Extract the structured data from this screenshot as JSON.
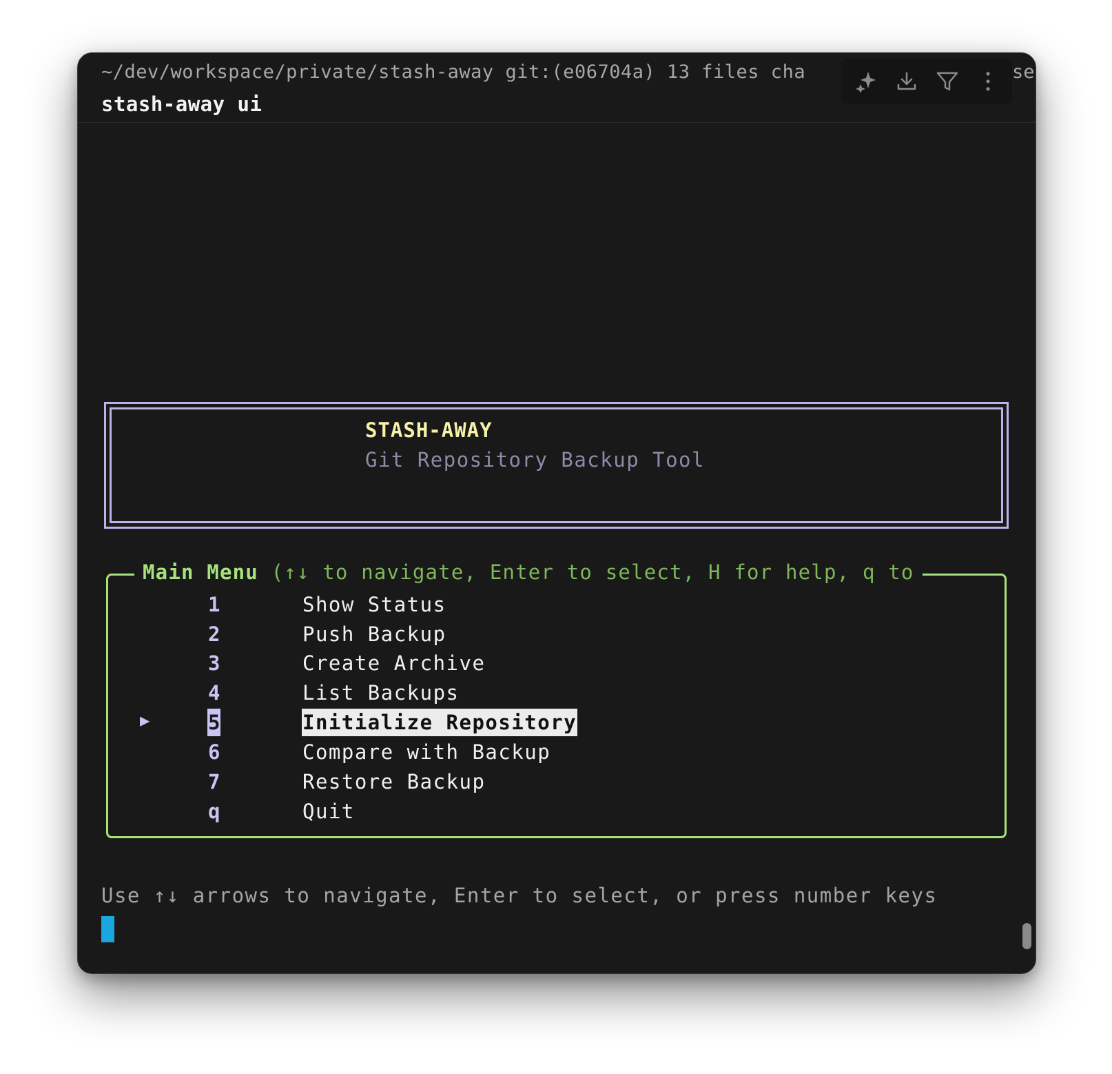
{
  "terminal": {
    "prompt_line": "~/dev/workspace/private/stash-away git:(e06704a)  13 files cha",
    "prompt_overflow": "se",
    "command": "stash-away ui",
    "toolbar": {
      "icons": [
        "sparkle-icon",
        "download-icon",
        "filter-icon",
        "more-vertical-icon"
      ]
    }
  },
  "banner": {
    "title": "STASH-AWAY",
    "subtitle": "Git Repository Backup Tool"
  },
  "menu": {
    "title": "Main Menu",
    "hint": "(↑↓ to navigate, Enter to select, H for help, q to",
    "pointer": "▶",
    "selected_index": 4,
    "items": [
      {
        "key": "1",
        "label": "Show Status"
      },
      {
        "key": "2",
        "label": "Push Backup"
      },
      {
        "key": "3",
        "label": "Create Archive"
      },
      {
        "key": "4",
        "label": "List Backups"
      },
      {
        "key": "5",
        "label": "Initialize Repository"
      },
      {
        "key": "6",
        "label": "Compare with Backup"
      },
      {
        "key": "7",
        "label": "Restore Backup"
      },
      {
        "key": "q",
        "label": "Quit"
      }
    ]
  },
  "footer": {
    "help": "Use ↑↓ arrows to navigate, Enter to select, or press number keys"
  },
  "colors": {
    "background": "#191919",
    "banner_border": "#b9b5ea",
    "banner_title": "#f7f1a9",
    "menu_border": "#a6e37c",
    "key_color": "#c8c4f3",
    "cursor": "#1aa7e0"
  }
}
